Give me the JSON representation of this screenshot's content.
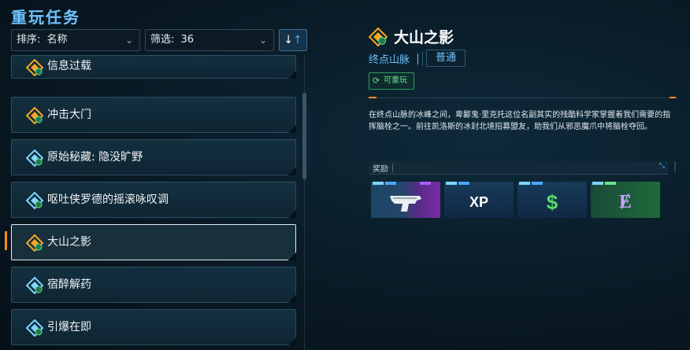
{
  "header": {
    "title": "重玩任务"
  },
  "controls": {
    "sort": {
      "label": "排序:",
      "value": "名称"
    },
    "filter": {
      "label": "筛选:",
      "value": "36"
    },
    "sort_direction_icon": "sort-down-up-arrows"
  },
  "missions": [
    {
      "name": "信息过载",
      "icon": "main-mission-icon"
    },
    {
      "name": "冲击大门",
      "icon": "main-mission-icon"
    },
    {
      "name": "原始秘藏: 隐没旷野",
      "icon": "side-mission-icon"
    },
    {
      "name": "呕吐侠罗德的摇滚咏叹调",
      "icon": "side-mission-icon"
    },
    {
      "name": "大山之影",
      "icon": "main-mission-icon",
      "selected": true
    },
    {
      "name": "宿醉解药",
      "icon": "side-mission-icon"
    },
    {
      "name": "引爆在即",
      "icon": "side-mission-icon"
    }
  ],
  "detail": {
    "title": "大山之影",
    "region": "终点山脉",
    "difficulty": "普通",
    "badge": "可重玩",
    "description": "在终点山脉的冰峰之间，卑鄙鬼·里克托这位名副其实的残酷科学家掌握着我们需要的指挥脑栓之一。前往凯洛斯的冰封北境招募盟友，助我们从邪恶魔爪中将脑栓夺回。",
    "rewards_label": "奖励",
    "rewards": [
      {
        "type": "weapon",
        "icon": "pistol-icon"
      },
      {
        "type": "xp",
        "text": "XP"
      },
      {
        "type": "cash",
        "text": "$"
      },
      {
        "type": "eridium",
        "text": "Ɇ"
      }
    ]
  },
  "colors": {
    "accent_blue": "#6fc3ff",
    "selection_orange": "#ff8a1f",
    "replay_green": "#6be28a",
    "main_mission_orange": "#f5a623",
    "side_mission_blue": "#7fd4ff"
  }
}
